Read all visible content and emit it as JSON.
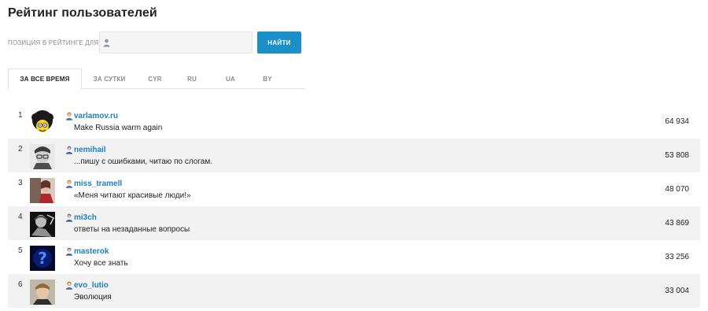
{
  "page": {
    "title": "Рейтинг пользователей"
  },
  "search": {
    "label": "ПОЗИЦИЯ В РЕЙТИНГЕ ДЛЯ",
    "value": "",
    "button_label": "НАЙТИ"
  },
  "tabs": [
    {
      "label": "ЗА ВСЕ ВРЕМЯ",
      "active": true
    },
    {
      "label": "ЗА СУТКИ",
      "active": false
    },
    {
      "label": "CYR",
      "active": false
    },
    {
      "label": "RU",
      "active": false
    },
    {
      "label": "UA",
      "active": false
    },
    {
      "label": "BY",
      "active": false
    }
  ],
  "users": [
    {
      "rank": "1",
      "username": "varlamov.ru",
      "status": "Make Russia warm again",
      "score": "64 934",
      "gender": "female"
    },
    {
      "rank": "2",
      "username": "nemihail",
      "status": "...пишу с ошибками, читаю по слогам.",
      "score": "53 808",
      "gender": "male"
    },
    {
      "rank": "3",
      "username": "miss_tramell",
      "status": "«Меня читают красивые люди!»",
      "score": "48 070",
      "gender": "female"
    },
    {
      "rank": "4",
      "username": "mi3ch",
      "status": "ответы на незаданные вопросы",
      "score": "43 869",
      "gender": "male"
    },
    {
      "rank": "5",
      "username": "masterok",
      "status": "Хочу все знать",
      "score": "33 256",
      "gender": "male"
    },
    {
      "rank": "6",
      "username": "evo_lutio",
      "status": "Эволюция",
      "score": "33 004",
      "gender": "female"
    }
  ],
  "colors": {
    "accent": "#1c8fc9",
    "link": "#1f7fbd",
    "row_alt": "#f2f2f2"
  }
}
